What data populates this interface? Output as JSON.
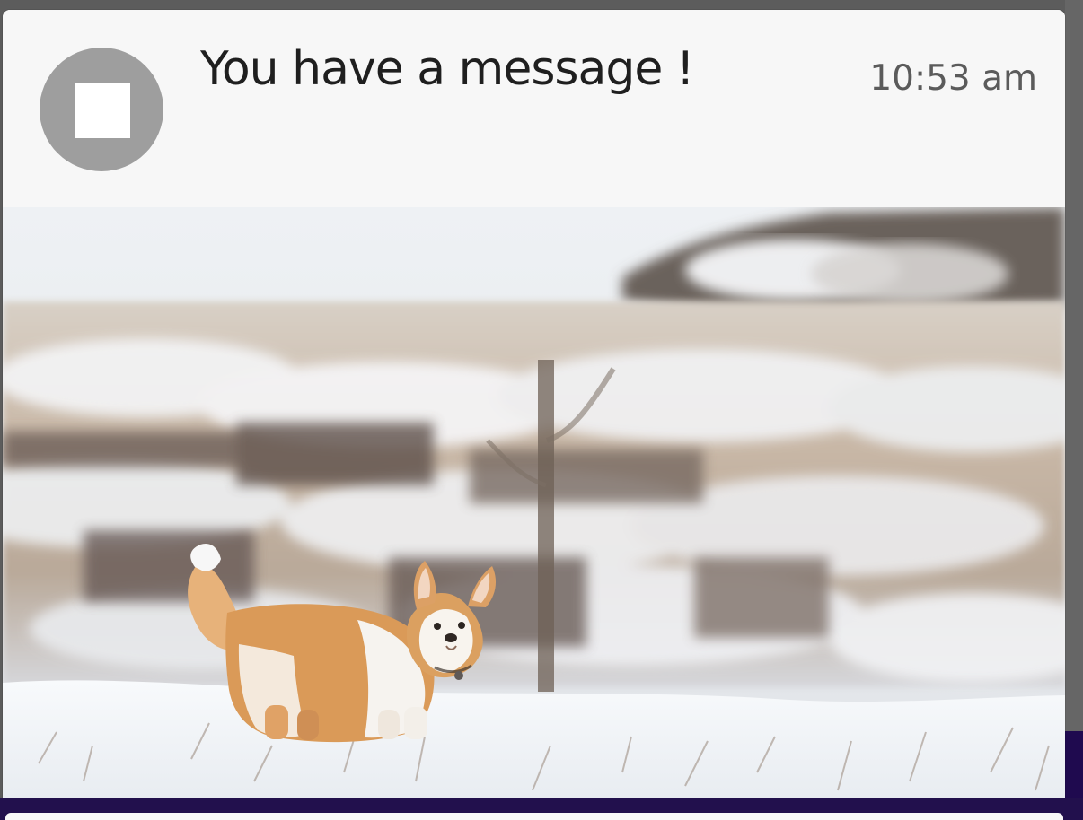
{
  "notification": {
    "title": "You have a message !",
    "time": "10:53 am",
    "avatar_icon": "stop-square-icon",
    "image_subject": "corgi-in-snow-image"
  },
  "colors": {
    "background": "#5c5c5c",
    "card": "#f7f7f7",
    "avatar": "#9e9e9e",
    "text_primary": "#1f1f1f",
    "text_time": "#5b5b5b",
    "bottom_bar": "#22104d",
    "purple_strip": "#1f0a4f"
  }
}
